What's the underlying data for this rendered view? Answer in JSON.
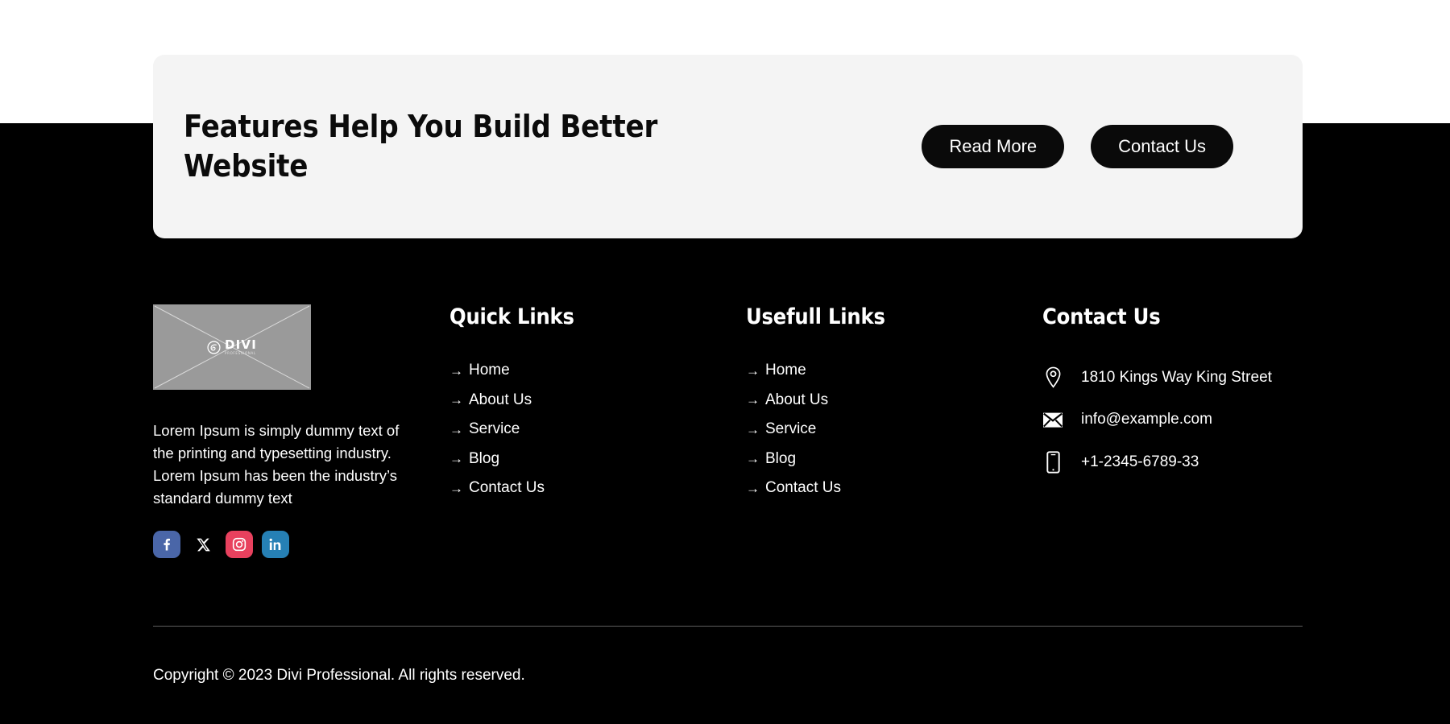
{
  "theme": {
    "page_bg": "#ffffff",
    "footer_bg": "#000000",
    "card_bg": "#f4f4f4",
    "button_bg": "#0a0a0a",
    "text_light": "#ffffff",
    "divider": "#5d5d5d",
    "logo_placeholder_bg": "#9a9a9a"
  },
  "cta": {
    "heading": "Features Help You Build Better Website",
    "read_more_label": "Read More",
    "contact_label": "Contact Us"
  },
  "brand": {
    "logo_word": "DIVI",
    "logo_subtext": "PROFESSIONAL",
    "logo_icon": "divi-swirl-icon",
    "description": "Lorem Ipsum is simply dummy text of the printing and typesetting industry. Lorem Ipsum has been the industry’s standard dummy text",
    "socials": [
      {
        "name": "facebook",
        "icon": "facebook-icon",
        "color": "#4a66a8"
      },
      {
        "name": "x-twitter",
        "icon": "x-twitter-icon",
        "color": "#000000"
      },
      {
        "name": "instagram",
        "icon": "instagram-icon",
        "color": "#e8415e"
      },
      {
        "name": "linkedin",
        "icon": "linkedin-icon",
        "color": "#2680b5"
      }
    ]
  },
  "quick_links": {
    "title": "Quick Links",
    "bullet": "→",
    "items": [
      {
        "label": "Home"
      },
      {
        "label": "About Us"
      },
      {
        "label": "Service"
      },
      {
        "label": "Blog"
      },
      {
        "label": "Contact Us"
      }
    ]
  },
  "useful_links": {
    "title": "Usefull Links",
    "bullet": "→",
    "items": [
      {
        "label": "Home"
      },
      {
        "label": "About Us"
      },
      {
        "label": "Service"
      },
      {
        "label": "Blog"
      },
      {
        "label": "Contact Us"
      }
    ]
  },
  "contact": {
    "title": "Contact Us",
    "items": [
      {
        "icon": "map-pin-icon",
        "value": "1810 Kings Way King Street"
      },
      {
        "icon": "envelope-icon",
        "value": "info@example.com"
      },
      {
        "icon": "mobile-phone-icon",
        "value": "+1-2345-6789-33"
      }
    ]
  },
  "footer_bottom": {
    "copyright": "Copyright © 2023 Divi Professional. All rights reserved."
  }
}
